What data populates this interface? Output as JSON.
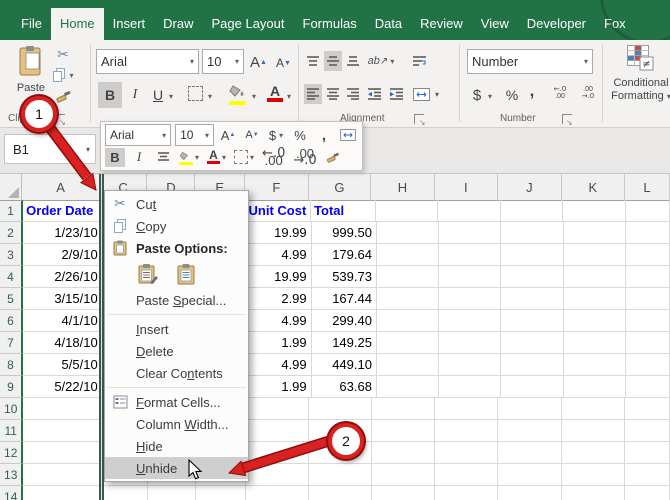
{
  "tabs": {
    "items": [
      {
        "label": "File",
        "selected": false
      },
      {
        "label": "Home",
        "selected": true
      },
      {
        "label": "Insert",
        "selected": false
      },
      {
        "label": "Draw",
        "selected": false
      },
      {
        "label": "Page Layout",
        "selected": false
      },
      {
        "label": "Formulas",
        "selected": false
      },
      {
        "label": "Data",
        "selected": false
      },
      {
        "label": "Review",
        "selected": false
      },
      {
        "label": "View",
        "selected": false
      },
      {
        "label": "Developer",
        "selected": false
      },
      {
        "label": "Fox",
        "selected": false
      }
    ]
  },
  "ribbon": {
    "clipboard": {
      "paste_label": "Paste",
      "group_label": "Clipboard"
    },
    "font": {
      "font_name": "Arial",
      "font_size": "10",
      "bold": "B",
      "italic": "I",
      "underline": "U"
    },
    "alignment": {
      "group_label": "Alignment",
      "orientation_text": "ab"
    },
    "number": {
      "format_value": "Number",
      "group_label": "Number",
      "currency": "$",
      "percent": "%",
      "comma": ","
    },
    "conditional": {
      "line1": "Conditional",
      "line2": "Formatting"
    }
  },
  "mini_toolbar": {
    "font_name": "Arial",
    "font_size": "10",
    "bold": "B",
    "italic": "I",
    "currency": "$",
    "percent": "%",
    "comma": ","
  },
  "formula_bar": {
    "name_box_value": "B1"
  },
  "sheet": {
    "columns": [
      "A",
      "C",
      "D",
      "E",
      "F",
      "G",
      "H",
      "I",
      "J",
      "K",
      "L"
    ],
    "row_numbers": [
      1,
      2,
      3,
      4,
      5,
      6,
      7,
      8,
      9,
      10,
      11,
      12,
      13,
      14
    ],
    "cells": {
      "A1": "Order Date",
      "F1": "Unit Cost",
      "G1": "Total"
    },
    "data_rows": [
      {
        "date": "1/23/10",
        "unit_cost": "19.99",
        "total": "999.50"
      },
      {
        "date": "2/9/10",
        "unit_cost": "4.99",
        "total": "179.64"
      },
      {
        "date": "2/26/10",
        "unit_cost": "19.99",
        "total": "539.73"
      },
      {
        "date": "3/15/10",
        "unit_cost": "2.99",
        "total": "167.44"
      },
      {
        "date": "4/1/10",
        "unit_cost": "4.99",
        "total": "299.40"
      },
      {
        "date": "4/18/10",
        "unit_cost": "1.99",
        "total": "149.25"
      },
      {
        "date": "5/5/10",
        "unit_cost": "4.99",
        "total": "449.10"
      },
      {
        "date": "5/22/10",
        "unit_cost": "1.99",
        "total": "63.68"
      }
    ]
  },
  "context_menu": {
    "items": [
      {
        "type": "item",
        "label": "Cut",
        "underline": 2,
        "icon": "scissors-icon"
      },
      {
        "type": "item",
        "label": "Copy",
        "underline": 0,
        "icon": "copy-icon"
      },
      {
        "type": "item",
        "label": "Paste Options:",
        "underline": -1,
        "icon": "clipboard-icon",
        "bold": true
      },
      {
        "type": "paste-options",
        "buttons": [
          "paste-formatting-icon",
          "paste-icon"
        ]
      },
      {
        "type": "item",
        "label": "Paste Special...",
        "underline": 6
      },
      {
        "type": "separator"
      },
      {
        "type": "item",
        "label": "Insert",
        "underline": 0
      },
      {
        "type": "item",
        "label": "Delete",
        "underline": 0
      },
      {
        "type": "item",
        "label": "Clear Contents",
        "underline": 8
      },
      {
        "type": "separator"
      },
      {
        "type": "item",
        "label": "Format Cells...",
        "underline": 0,
        "icon": "format-cells-icon"
      },
      {
        "type": "item",
        "label": "Column Width...",
        "underline": 7
      },
      {
        "type": "item",
        "label": "Hide",
        "underline": 0
      },
      {
        "type": "item",
        "label": "Unhide",
        "underline": 0,
        "highlighted": true
      }
    ]
  },
  "annotations": {
    "step1": {
      "label": "1"
    },
    "step2": {
      "label": "2"
    },
    "red": "#d92121"
  },
  "colors": {
    "excel_green": "#217346",
    "header_blue_text": "#0000ff",
    "ribbon_bg": "#f3f2f1",
    "annotation_red": "#d92121"
  }
}
